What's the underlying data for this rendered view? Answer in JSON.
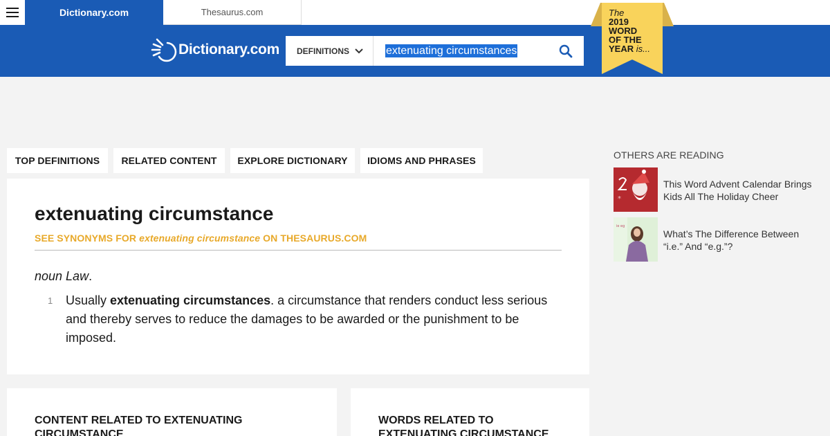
{
  "topbar": {
    "menu_icon": "hamburger-icon",
    "tabs": [
      {
        "label": "Dictionary.com",
        "active": true
      },
      {
        "label": "Thesaurus.com",
        "active": false
      }
    ]
  },
  "header": {
    "logo_text": "Dictionary.com",
    "search": {
      "select_label": "DEFINITIONS",
      "query": "extenuating circumstances",
      "search_icon": "search-icon"
    },
    "word_of_year": {
      "line1": "The",
      "line2": "2019",
      "line3": "WORD",
      "line4": "OF THE",
      "line5": "YEAR",
      "line5_suffix": "is..."
    }
  },
  "section_tabs": [
    {
      "label": "TOP DEFINITIONS"
    },
    {
      "label": "RELATED CONTENT"
    },
    {
      "label": "EXPLORE DICTIONARY"
    },
    {
      "label": "IDIOMS AND PHRASES"
    }
  ],
  "entry": {
    "headword": "extenuating circumstance",
    "synonyms_prefix": "SEE SYNONYMS FOR ",
    "synonyms_word": "extenuating circumstance",
    "synonyms_suffix": " ON THESAURUS.COM",
    "part_of_speech": "noun Law",
    "pos_period": ".",
    "definitions": [
      {
        "number": "1",
        "lead": "Usually ",
        "bold": "extenuating circumstances",
        "rest": ". a circumstance that renders conduct less serious and thereby serves to reduce the damages to be awarded or the punishment to be imposed."
      }
    ]
  },
  "bottom_cards": [
    {
      "title": "CONTENT RELATED TO EXTENUATING CIRCUMSTANCE"
    },
    {
      "title": "WORDS RELATED TO EXTENUATING CIRCUMSTANCE"
    }
  ],
  "sidebar": {
    "heading": "OTHERS ARE READING",
    "items": [
      {
        "title": "This Word Advent Calendar Brings Kids All The Holiday Cheer",
        "thumb_color": "#b52a2f"
      },
      {
        "title": "What’s The Difference Between “i.e.” And “e.g.”?",
        "thumb_color": "#dff0d8"
      }
    ]
  },
  "colors": {
    "brand_blue": "#1a5bb5",
    "accent_gold": "#e8a92a",
    "ribbon_yellow": "#f9d35b"
  }
}
